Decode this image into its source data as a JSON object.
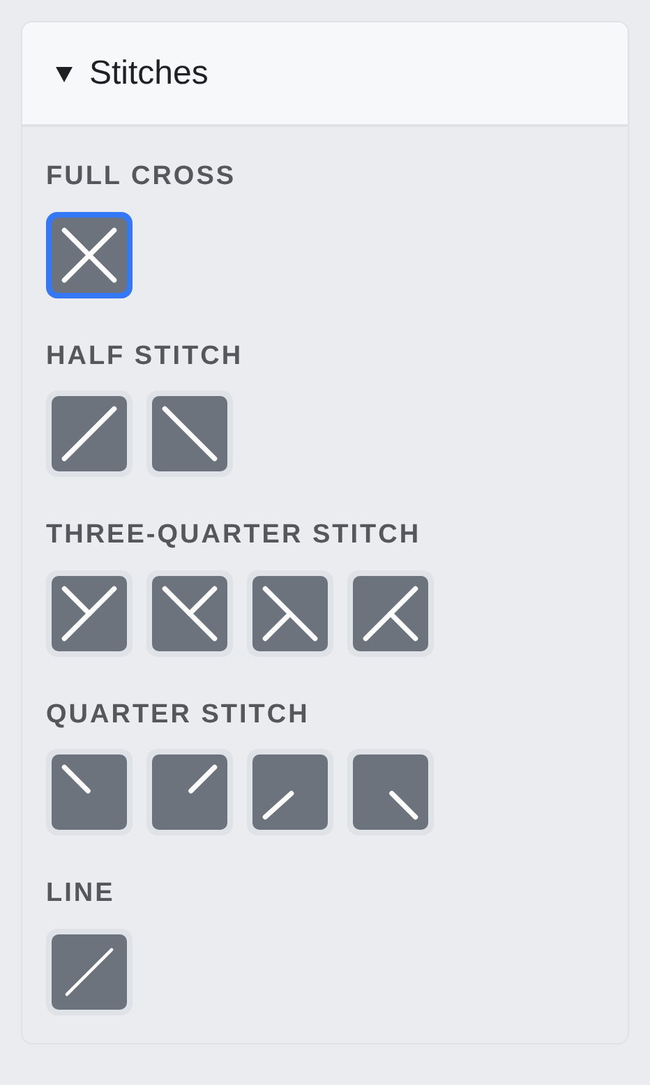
{
  "panel": {
    "title": "Stitches",
    "expanded": true
  },
  "sections": [
    {
      "label": "FULL CROSS",
      "stitches": [
        {
          "kind": "full",
          "selected": true
        }
      ]
    },
    {
      "label": "HALF STITCH",
      "stitches": [
        {
          "kind": "half-forward",
          "selected": false
        },
        {
          "kind": "half-back",
          "selected": false
        }
      ]
    },
    {
      "label": "THREE-QUARTER STITCH",
      "stitches": [
        {
          "kind": "tq-tl",
          "selected": false
        },
        {
          "kind": "tq-tr",
          "selected": false
        },
        {
          "kind": "tq-bl",
          "selected": false
        },
        {
          "kind": "tq-br",
          "selected": false
        }
      ]
    },
    {
      "label": "QUARTER STITCH",
      "stitches": [
        {
          "kind": "q-tl",
          "selected": false
        },
        {
          "kind": "q-tr",
          "selected": false
        },
        {
          "kind": "q-bl",
          "selected": false
        },
        {
          "kind": "q-br",
          "selected": false
        }
      ]
    },
    {
      "label": "LINE",
      "stitches": [
        {
          "kind": "line",
          "selected": false
        }
      ]
    }
  ]
}
